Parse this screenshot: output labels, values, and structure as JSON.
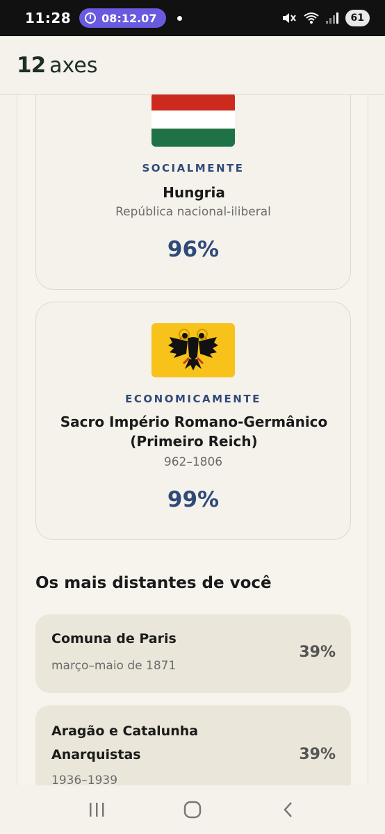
{
  "status_bar": {
    "time": "11:28",
    "timer": "08:12.07",
    "battery": "61"
  },
  "header": {
    "logo_number": "12",
    "logo_word": "axes"
  },
  "cards": [
    {
      "category": "SOCIALMENTE",
      "name": "Hungria",
      "subtitle": "República nacional-iliberal",
      "percent": "96%",
      "flag_icon": "hungary-flag-icon"
    },
    {
      "category": "ECONOMICAMENTE",
      "name": "Sacro Império Romano-Germânico (Primeiro Reich)",
      "subtitle": "962–1806",
      "percent": "99%",
      "flag_icon": "holy-roman-empire-flag-icon"
    }
  ],
  "distant_section": {
    "title": "Os mais distantes de você",
    "items": [
      {
        "title": "Comuna de Paris",
        "subtitle": "março–maio de 1871",
        "percent": "39%"
      },
      {
        "title": "Aragão e Catalunha Anarquistas",
        "subtitle": "1936–1939",
        "percent": "39%"
      }
    ]
  },
  "colors": {
    "accent": "#2f4a7a",
    "background": "#f5f2eb",
    "row_background": "#ebe6da",
    "timer_pill": "#6a5ae0"
  }
}
